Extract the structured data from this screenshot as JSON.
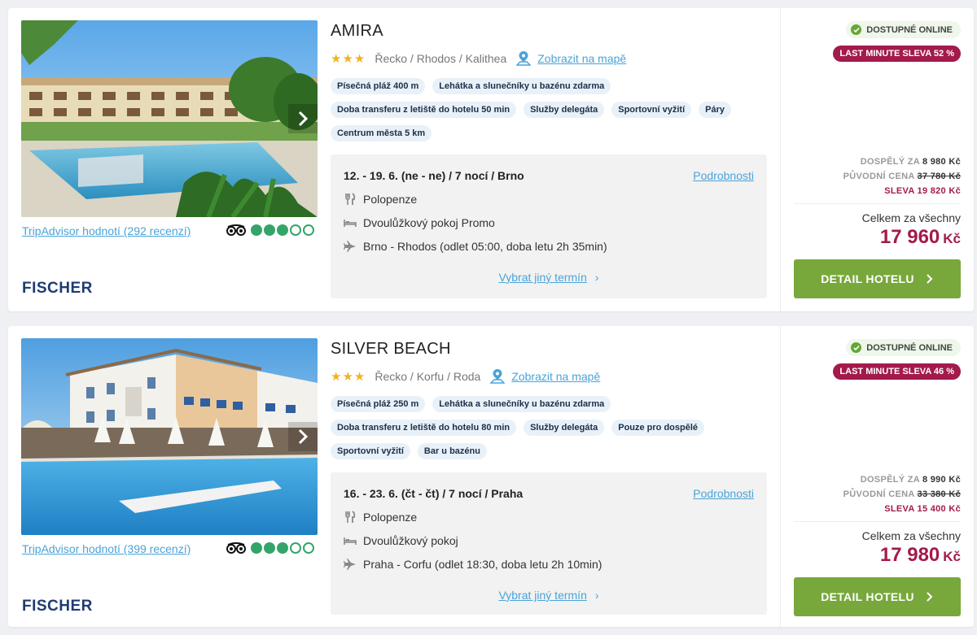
{
  "colors": {
    "accent_link": "#4aa3d8",
    "discount": "#a31a4c",
    "button": "#78a83c",
    "online_check": "#65a736",
    "stars": "#f0b323",
    "tripadvisor": "#34a56a"
  },
  "hotels": [
    {
      "name": "AMIRA",
      "stars": 3,
      "location": "Řecko / Rhodos / Kalithea",
      "map_link": "Zobrazit na mapě",
      "tags": [
        "Písečná pláž 400 m",
        "Lehátka a slunečníky u bazénu zdarma",
        "Doba transferu z letiště do hotelu 50 min",
        "Služby delegáta",
        "Sportovní vyžití",
        "Páry",
        "Centrum města 5 km"
      ],
      "tripadvisor_text": "TripAdvisor hodnotí (292 recenzí)",
      "tripadvisor_rating": 3,
      "brand": "FISCHER",
      "term": "12. - 19. 6. (ne - ne) / 7 nocí / Brno",
      "details_link": "Podrobnosti",
      "board": "Polopenze",
      "room": "Dvoulůžkový pokoj Promo",
      "flight": "Brno - Rhodos (odlet 05:00, doba letu 2h 35min)",
      "other_term": "Vybrat jiný termín",
      "online_badge": "DOSTUPNÉ ONLINE",
      "discount_badge": "LAST MINUTE SLEVA 52 %",
      "adult_label": "DOSPĚLÝ ZA",
      "adult_price": "8 980 Kč",
      "original_label": "PŮVODNÍ CENA",
      "original_price": "37 780 Kč",
      "discount_label": "SLEVA",
      "discount_amount": "19 820 Kč",
      "total_label": "Celkem za všechny",
      "total_price": "17 960",
      "total_currency": "Kč",
      "button": "DETAIL HOTELU"
    },
    {
      "name": "SILVER BEACH",
      "stars": 3,
      "location": "Řecko / Korfu / Roda",
      "map_link": "Zobrazit na mapě",
      "tags": [
        "Písečná pláž 250 m",
        "Lehátka a slunečníky u bazénu zdarma",
        "Doba transferu z letiště do hotelu 80 min",
        "Služby delegáta",
        "Pouze pro dospělé",
        "Sportovní vyžití",
        "Bar u bazénu"
      ],
      "tripadvisor_text": "TripAdvisor hodnotí (399 recenzí)",
      "tripadvisor_rating": 3,
      "brand": "FISCHER",
      "term": "16. - 23. 6. (čt - čt) / 7 nocí / Praha",
      "details_link": "Podrobnosti",
      "board": "Polopenze",
      "room": "Dvoulůžkový pokoj",
      "flight": "Praha - Corfu (odlet 18:30, doba letu 2h 10min)",
      "other_term": "Vybrat jiný termín",
      "online_badge": "DOSTUPNÉ ONLINE",
      "discount_badge": "LAST MINUTE SLEVA 46 %",
      "adult_label": "DOSPĚLÝ ZA",
      "adult_price": "8 990 Kč",
      "original_label": "PŮVODNÍ CENA",
      "original_price": "33 380 Kč",
      "discount_label": "SLEVA",
      "discount_amount": "15 400 Kč",
      "total_label": "Celkem za všechny",
      "total_price": "17 980",
      "total_currency": "Kč",
      "button": "DETAIL HOTELU"
    }
  ]
}
